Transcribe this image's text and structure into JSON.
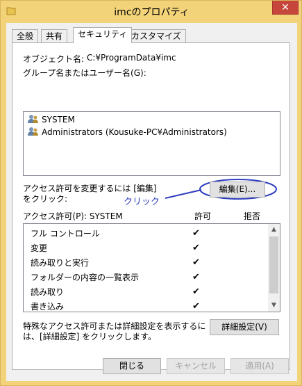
{
  "window": {
    "title": "imcのプロパティ",
    "close_label": "✕"
  },
  "tabs": [
    "全般",
    "共有",
    "セキュリティ",
    "カスタマイズ"
  ],
  "object_name": {
    "label": "オブジェクト名:",
    "value": "C:¥ProgramData¥imc"
  },
  "group_label": "グループ名またはユーザー名(G):",
  "users": [
    "SYSTEM",
    "Administrators (Kousuke-PC¥Administrators)"
  ],
  "edit_hint": [
    "アクセス許可を変更するには [編集]",
    "をクリック:"
  ],
  "edit_button": "編集(E)...",
  "annotation": "クリック",
  "permissions": {
    "header": "アクセス許可(P): SYSTEM",
    "allow_header": "許可",
    "deny_header": "拒否",
    "rows": [
      {
        "name": "フル コントロール",
        "allow": "✔"
      },
      {
        "name": "変更",
        "allow": "✔"
      },
      {
        "name": "読み取りと実行",
        "allow": "✔"
      },
      {
        "name": "フォルダーの内容の一覧表示",
        "allow": "✔"
      },
      {
        "name": "読み取り",
        "allow": "✔"
      },
      {
        "name": "書き込み",
        "allow": "✔"
      }
    ]
  },
  "advanced_hint": [
    "特殊なアクセス許可または詳細設定を表示するに",
    "は、[詳細設定] をクリックします。"
  ],
  "advanced_button": "詳細設定(V)",
  "footer": {
    "close": "閉じる",
    "cancel": "キャンセル",
    "apply": "適用(A)"
  },
  "colors": {
    "frame": "#f3d37a",
    "close": "#c7463b",
    "annotation": "#2f3fbf"
  }
}
